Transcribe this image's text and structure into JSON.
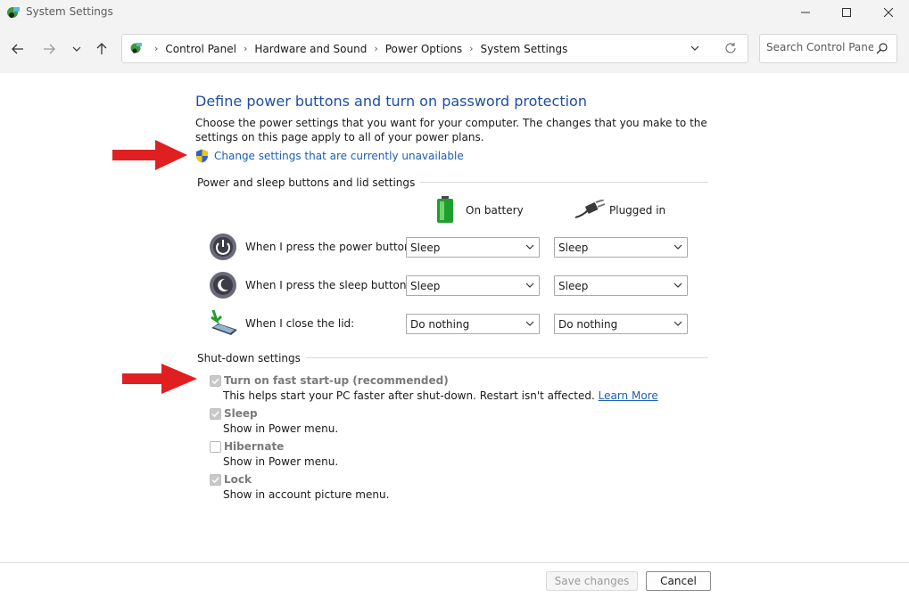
{
  "window": {
    "title": "System Settings",
    "icon": "control-panel-icon"
  },
  "address_bar": {
    "breadcrumbs": [
      "Control Panel",
      "Hardware and Sound",
      "Power Options",
      "System Settings"
    ]
  },
  "search": {
    "placeholder": "Search Control Panel"
  },
  "page": {
    "heading": "Define power buttons and turn on password protection",
    "description": "Choose the power settings that you want for your computer. The changes that you make to the settings on this page apply to all of your power plans.",
    "change_link": "Change settings that are currently unavailable"
  },
  "power_section": {
    "title": "Power and sleep buttons and lid settings",
    "col_battery": "On battery",
    "col_plugged": "Plugged in",
    "rows": [
      {
        "label": "When I press the power button:",
        "battery": "Sleep",
        "plugged": "Sleep"
      },
      {
        "label": "When I press the sleep button:",
        "battery": "Sleep",
        "plugged": "Sleep"
      },
      {
        "label": "When I close the lid:",
        "battery": "Do nothing",
        "plugged": "Do nothing"
      }
    ]
  },
  "shutdown_section": {
    "title": "Shut-down settings",
    "items": [
      {
        "label": "Turn on fast start-up (recommended)",
        "sub": "This helps start your PC faster after shut-down. Restart isn't affected.",
        "link": "Learn More",
        "checked": true
      },
      {
        "label": "Sleep",
        "sub": "Show in Power menu.",
        "checked": true
      },
      {
        "label": "Hibernate",
        "sub": "Show in Power menu.",
        "checked": false
      },
      {
        "label": "Lock",
        "sub": "Show in account picture menu.",
        "checked": true
      }
    ]
  },
  "footer": {
    "save_label": "Save changes",
    "cancel_label": "Cancel"
  },
  "colors": {
    "heading": "#1f4e9c",
    "link": "#1a5fb4",
    "annotation_arrow": "#e02020"
  }
}
